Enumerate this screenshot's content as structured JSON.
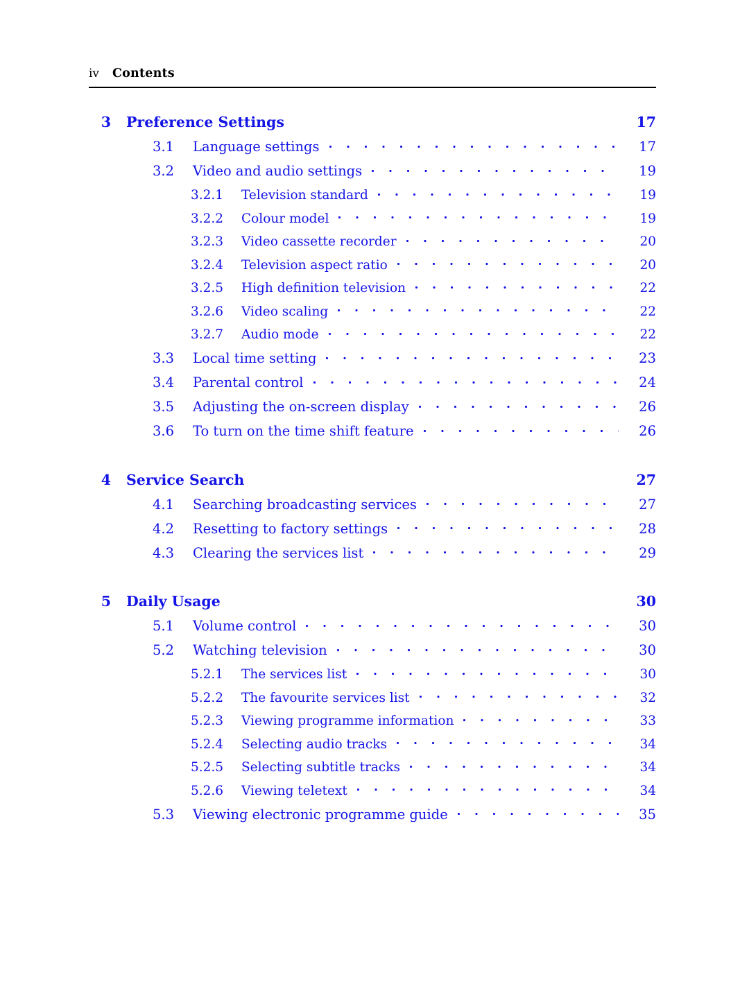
{
  "header": {
    "folio": "iv",
    "title": "Contents"
  },
  "entries": [
    {
      "level": "chap",
      "num": "3",
      "title": "Preference Settings",
      "page": "17",
      "leader": false,
      "gap_before": false
    },
    {
      "level": "sec",
      "num": "3.1",
      "title": "Language settings",
      "page": "17",
      "leader": true,
      "gap_before": false
    },
    {
      "level": "sec",
      "num": "3.2",
      "title": "Video and audio settings",
      "page": "19",
      "leader": true,
      "gap_before": false
    },
    {
      "level": "sub",
      "num": "3.2.1",
      "title": "Television standard",
      "page": "19",
      "leader": true,
      "gap_before": false
    },
    {
      "level": "sub",
      "num": "3.2.2",
      "title": "Colour model",
      "page": "19",
      "leader": true,
      "gap_before": false
    },
    {
      "level": "sub",
      "num": "3.2.3",
      "title": "Video cassette recorder",
      "page": "20",
      "leader": true,
      "gap_before": false
    },
    {
      "level": "sub",
      "num": "3.2.4",
      "title": "Television aspect ratio",
      "page": "20",
      "leader": true,
      "gap_before": false
    },
    {
      "level": "sub",
      "num": "3.2.5",
      "title": "High definition television",
      "page": "22",
      "leader": true,
      "gap_before": false
    },
    {
      "level": "sub",
      "num": "3.2.6",
      "title": "Video scaling",
      "page": "22",
      "leader": true,
      "gap_before": false
    },
    {
      "level": "sub",
      "num": "3.2.7",
      "title": "Audio mode",
      "page": "22",
      "leader": true,
      "gap_before": false
    },
    {
      "level": "sec",
      "num": "3.3",
      "title": "Local time setting",
      "page": "23",
      "leader": true,
      "gap_before": false
    },
    {
      "level": "sec",
      "num": "3.4",
      "title": "Parental control",
      "page": "24",
      "leader": true,
      "gap_before": false
    },
    {
      "level": "sec",
      "num": "3.5",
      "title": "Adjusting the on-screen display",
      "page": "26",
      "leader": true,
      "gap_before": false
    },
    {
      "level": "sec",
      "num": "3.6",
      "title": "To turn on the time shift feature",
      "page": "26",
      "leader": true,
      "gap_before": false
    },
    {
      "level": "chap",
      "num": "4",
      "title": "Service Search",
      "page": "27",
      "leader": false,
      "gap_before": true
    },
    {
      "level": "sec",
      "num": "4.1",
      "title": "Searching broadcasting services",
      "page": "27",
      "leader": true,
      "gap_before": false
    },
    {
      "level": "sec",
      "num": "4.2",
      "title": "Resetting to factory settings",
      "page": "28",
      "leader": true,
      "gap_before": false
    },
    {
      "level": "sec",
      "num": "4.3",
      "title": "Clearing the services list",
      "page": "29",
      "leader": true,
      "gap_before": false
    },
    {
      "level": "chap",
      "num": "5",
      "title": "Daily Usage",
      "page": "30",
      "leader": false,
      "gap_before": true
    },
    {
      "level": "sec",
      "num": "5.1",
      "title": "Volume control",
      "page": "30",
      "leader": true,
      "gap_before": false
    },
    {
      "level": "sec",
      "num": "5.2",
      "title": "Watching television",
      "page": "30",
      "leader": true,
      "gap_before": false
    },
    {
      "level": "sub",
      "num": "5.2.1",
      "title": "The services list",
      "page": "30",
      "leader": true,
      "gap_before": false
    },
    {
      "level": "sub",
      "num": "5.2.2",
      "title": "The favourite services list",
      "page": "32",
      "leader": true,
      "gap_before": false
    },
    {
      "level": "sub",
      "num": "5.2.3",
      "title": "Viewing programme information",
      "page": "33",
      "leader": true,
      "gap_before": false
    },
    {
      "level": "sub",
      "num": "5.2.4",
      "title": "Selecting audio tracks",
      "page": "34",
      "leader": true,
      "gap_before": false
    },
    {
      "level": "sub",
      "num": "5.2.5",
      "title": "Selecting subtitle tracks",
      "page": "34",
      "leader": true,
      "gap_before": false
    },
    {
      "level": "sub",
      "num": "5.2.6",
      "title": "Viewing teletext",
      "page": "34",
      "leader": true,
      "gap_before": false
    },
    {
      "level": "sec",
      "num": "5.3",
      "title": "Viewing electronic programme guide",
      "page": "35",
      "leader": true,
      "gap_before": false
    }
  ],
  "colors": {
    "link": "#1414e6",
    "header_text": "#000000",
    "rule": "#000000",
    "background": "#ffffff"
  }
}
